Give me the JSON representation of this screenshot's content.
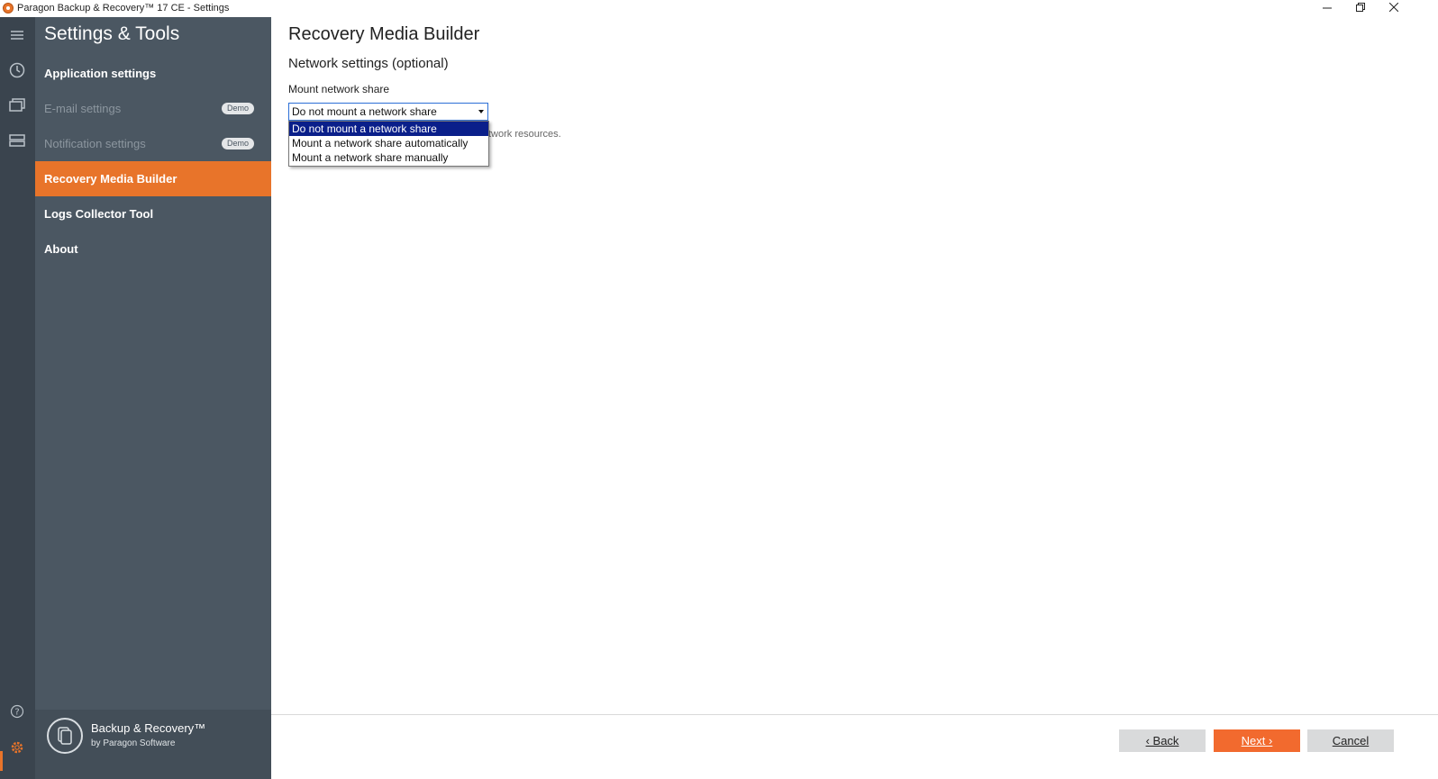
{
  "window": {
    "title": "Paragon Backup & Recovery™ 17 CE - Settings",
    "minimize_icon": "minimize-icon",
    "restore_icon": "restore-icon",
    "close_icon": "close-icon"
  },
  "rail": {
    "icons": [
      "menu-icon",
      "clock-icon",
      "backup-icon",
      "disk-icon",
      "help-icon",
      "gear-icon"
    ]
  },
  "sidebar": {
    "title": "Settings & Tools",
    "items": [
      {
        "label": "Application settings",
        "state": "normal"
      },
      {
        "label": "E-mail settings",
        "state": "disabled",
        "badge": "Demo"
      },
      {
        "label": "Notification settings",
        "state": "disabled",
        "badge": "Demo"
      },
      {
        "label": "Recovery Media Builder",
        "state": "active"
      },
      {
        "label": "Logs Collector Tool",
        "state": "normal"
      },
      {
        "label": "About",
        "state": "normal"
      }
    ],
    "brand": {
      "name": "Backup & Recovery™",
      "by": "by Paragon Software"
    }
  },
  "main": {
    "title": "Recovery Media Builder",
    "section": "Network settings (optional)",
    "field_label": "Mount network share",
    "select_value": "Do not mount a network share",
    "hint_visible": "twork resources.",
    "options": [
      "Do not mount a network share",
      "Mount a network share automatically",
      "Mount a network share manually"
    ],
    "selected_option": 0
  },
  "footer": {
    "back": "‹ Back",
    "next": "Next ›",
    "cancel": "Cancel"
  },
  "colors": {
    "accent": "#e8742a",
    "rail": "#3a444e",
    "sidebar": "#4b5762",
    "next_button": "#f26a2e",
    "dropdown_highlight": "#0a1f8a"
  }
}
